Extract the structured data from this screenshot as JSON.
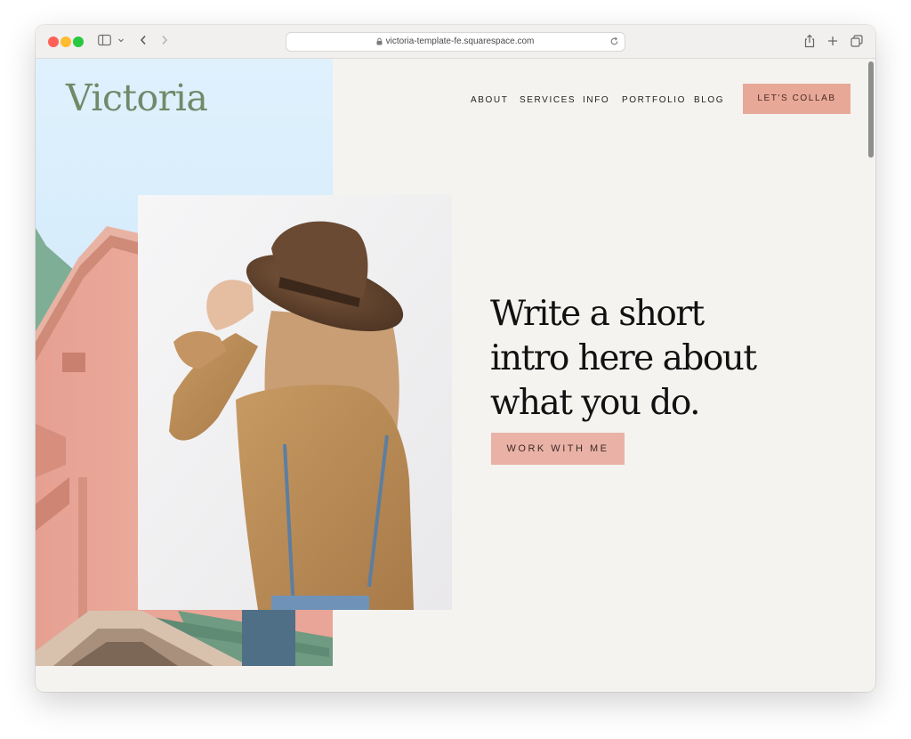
{
  "browser": {
    "url": "victoria-template-fe.squarespace.com"
  },
  "site": {
    "logo": "Victoria",
    "nav": [
      "ABOUT",
      "SERVICES",
      "INFO",
      "PORTFOLIO",
      "BLOG"
    ],
    "cta": "LET'S COLLAB"
  },
  "hero": {
    "headline_lines": [
      "Write a short",
      "intro here about",
      "what you do."
    ],
    "button": "WORK WITH ME"
  },
  "colors": {
    "page_bg": "#f5f3f0",
    "logo_green": "#708a69",
    "cta_pink": "#e8a898",
    "button_pink": "#eab2a6"
  }
}
